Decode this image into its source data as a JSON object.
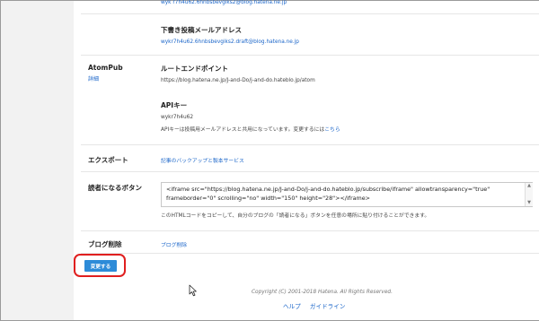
{
  "top_email_fragment": "wyk r7h4u62.6hnbsbevgiks2@blog.hatena.ne.jp",
  "draft": {
    "heading": "下書き投稿メールアドレス",
    "value": "wykr7h4u62.6hnbsbevgiks2.draft@blog.hatena.ne.jp"
  },
  "atompub": {
    "label": "AtomPub",
    "details_link": "詳細",
    "root_heading": "ルートエンドポイント",
    "root_url": "https://blog.hatena.ne.jp/J-and-Do/j-and-do.hateblo.jp/atom",
    "api_key_heading": "APIキー",
    "api_key_value": "wykr7h4u62",
    "api_key_note": "APIキーは投稿用メールアドレスと共用になっています。変更するには",
    "api_key_note_link": "こちら"
  },
  "export": {
    "label": "エクスポート",
    "link": "記事のバックアップと製本サービス"
  },
  "reader_button": {
    "label": "読者になるボタン",
    "code": "<iframe src=\"https://blog.hatena.ne.jp/J-and-Do/j-and-do.hateblo.jp/subscribe/iframe\" allowtransparency=\"true\" frameborder=\"0\" scrolling=\"no\" width=\"150\" height=\"28\"></iframe>",
    "help": "このHTMLコードをコピーして、自分のブログの「読者になる」ボタンを任意の場所に貼り付けることができます。"
  },
  "delete": {
    "label": "ブログ削除",
    "link": "ブログ削除"
  },
  "save_button": "変更する",
  "footer": {
    "copyright": "Copyright (C) 2001-2018 Hatena. All Rights Reserved.",
    "help": "ヘルプ",
    "guidelines": "ガイドライン"
  },
  "colors": {
    "link": "#1a65c9",
    "button": "#2d8bd8",
    "highlight": "#e01f1f"
  }
}
